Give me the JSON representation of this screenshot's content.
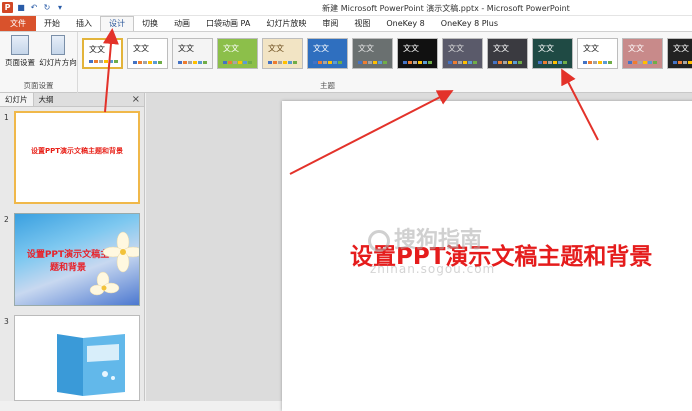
{
  "window": {
    "title": "新建 Microsoft PowerPoint 演示文稿.pptx - Microsoft PowerPoint"
  },
  "qat": {
    "app_icon": "P"
  },
  "tabs": [
    "文件",
    "开始",
    "插入",
    "设计",
    "切换",
    "动画",
    "口袋动画 PA",
    "幻灯片放映",
    "审阅",
    "视图",
    "OneKey 8",
    "OneKey 8 Plus"
  ],
  "ribbon": {
    "page_setup": {
      "btn1": "页面设置",
      "btn2": "幻灯片方向",
      "group": "页面设置"
    },
    "themes": {
      "group": "主题",
      "items": [
        {
          "label": "文文",
          "bg": "#ffffff",
          "fg": "#222222"
        },
        {
          "label": "文文",
          "bg": "#ffffff",
          "fg": "#222222"
        },
        {
          "label": "文文",
          "bg": "#f4f4f4",
          "fg": "#222222"
        },
        {
          "label": "文文",
          "bg": "#8cbf4a",
          "fg": "#ffffff"
        },
        {
          "label": "文文",
          "bg": "#f2e4c4",
          "fg": "#6a4a1a"
        },
        {
          "label": "文文",
          "bg": "#2f6fbf",
          "fg": "#ffffff"
        },
        {
          "label": "文文",
          "bg": "#6a7070",
          "fg": "#e8e8e8"
        },
        {
          "label": "文文",
          "bg": "#111111",
          "fg": "#ffffff"
        },
        {
          "label": "文文",
          "bg": "#5a5a6a",
          "fg": "#dddddd"
        },
        {
          "label": "文文",
          "bg": "#3a3a40",
          "fg": "#ffffff"
        },
        {
          "label": "文文",
          "bg": "#1f4a44",
          "fg": "#ffffff"
        },
        {
          "label": "文文",
          "bg": "#ffffff",
          "fg": "#222222"
        },
        {
          "label": "文文",
          "bg": "#c88a8a",
          "fg": "#ffffff"
        },
        {
          "label": "文文",
          "bg": "#222222",
          "fg": "#ffffff"
        }
      ]
    }
  },
  "left_panel": {
    "tab_slides": "幻灯片",
    "tab_outline": "大纲",
    "close": "×",
    "slides": [
      {
        "num": "1",
        "title": "设置PPT演示文稿主题和背景"
      },
      {
        "num": "2",
        "title_line1": "设置PPT演示文稿主",
        "title_line2": "题和背景"
      },
      {
        "num": "3"
      }
    ]
  },
  "slide": {
    "title": "设置PPT演示文稿主题和背景"
  },
  "watermark": {
    "text": "搜狗指南",
    "url": "zhinan.sogou.com"
  }
}
